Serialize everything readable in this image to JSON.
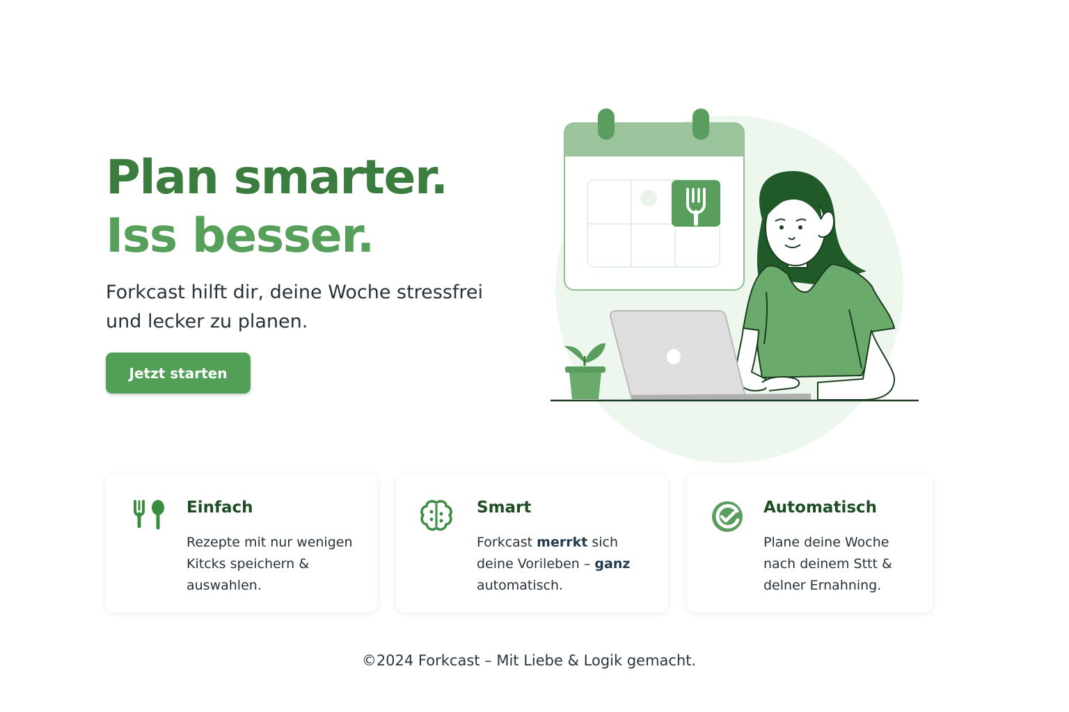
{
  "hero": {
    "headline_line1": "Plan smarter.",
    "headline_line2": "Iss besser.",
    "subline": "Forkcast hilft dir, deine Woche stressfrei und lecker zu planen.",
    "cta_label": "Jetzt starten"
  },
  "illustration": {
    "icons": [
      "calendar-icon",
      "fork-icon",
      "laptop-icon",
      "plant-icon",
      "woman-illustration"
    ]
  },
  "features": [
    {
      "icon": "fork-spoon-icon",
      "title": "Einfach",
      "text_line1": "Rezepte mit nur wenigen",
      "text_line2": "Kitcks speichern & auswahlen."
    },
    {
      "icon": "brain-icon",
      "title": "Smart",
      "text_pre": "Forkcast ",
      "text_bold1": "merrkt",
      "text_mid": " sich deine Vorileben – ",
      "text_bold2": "ganz",
      "text_post": " automatisch."
    },
    {
      "icon": "auto-check-icon",
      "title": "Automatisch",
      "text": "Plane deine Woche nach deinem Sttt & delner Ernahning."
    }
  ],
  "footer": {
    "text": "©2024 Forkcast – Mit Liebe & Logik gemacht."
  },
  "colors": {
    "primary_dark": "#3a7d3e",
    "primary": "#57a05c",
    "button": "#52a057",
    "card_title": "#1d4d22",
    "text": "#26313a"
  }
}
